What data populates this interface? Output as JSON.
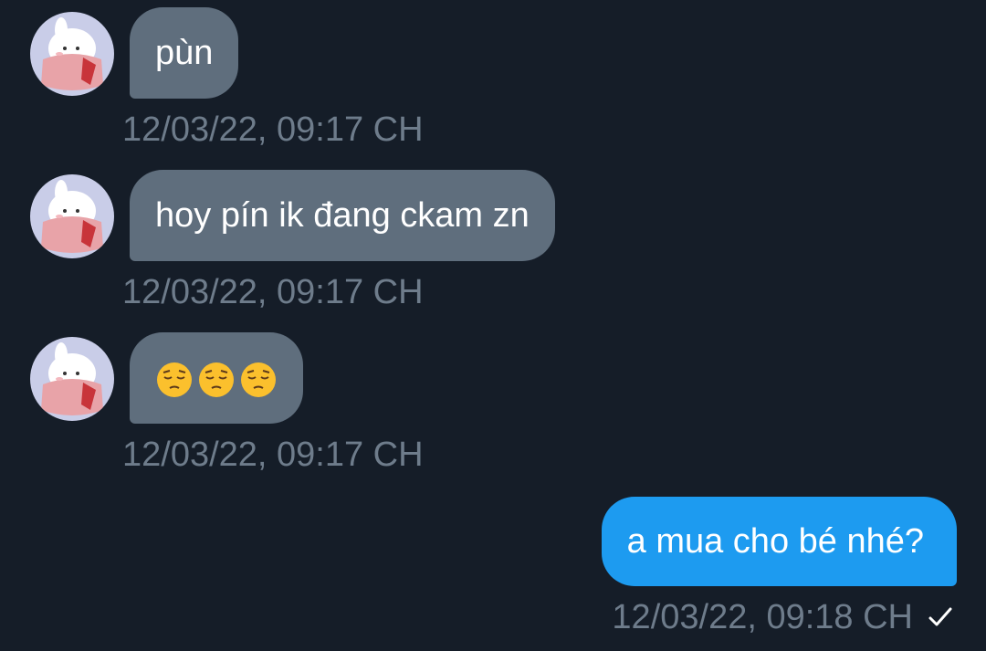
{
  "messages": [
    {
      "direction": "incoming",
      "text": "pùn",
      "timestamp": "12/03/22, 09:17 CH"
    },
    {
      "direction": "incoming",
      "text": "hoy pín ik đang ckam zn",
      "timestamp": "12/03/22, 09:17 CH"
    },
    {
      "direction": "incoming",
      "emojis": [
        "pensive-face-emoji",
        "pensive-face-emoji",
        "pensive-face-emoji"
      ],
      "timestamp": "12/03/22, 09:17 CH"
    },
    {
      "direction": "outgoing",
      "text": "a mua cho bé nhé?",
      "timestamp": "12/03/22, 09:18 CH",
      "status_icon": "check-icon"
    }
  ],
  "colors": {
    "background": "#151d28",
    "incoming_bubble": "#5f6e7d",
    "outgoing_bubble": "#1d9bf0",
    "timestamp": "#6e7c8b"
  }
}
